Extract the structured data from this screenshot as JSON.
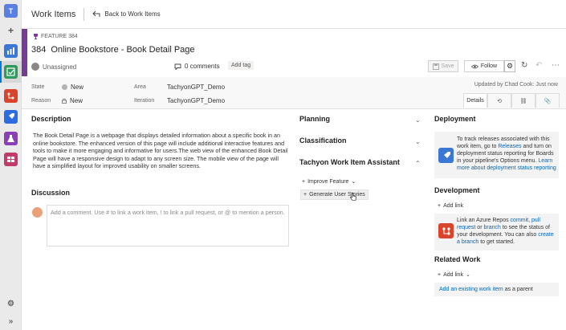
{
  "rail": {
    "avatar_letter": "T",
    "add_label": "+",
    "bottom_settings": "⚙",
    "bottom_expand": "»"
  },
  "header": {
    "title": "Work Items",
    "back_label": "Back to Work Items"
  },
  "work_item": {
    "type_label": "FEATURE 384",
    "id": "384",
    "title": "Online Bookstore - Book Detail Page",
    "assigned": "Unassigned",
    "comments": "0 comments",
    "add_tag": "Add tag",
    "save_label": "Save",
    "follow_label": "Follow",
    "accent_color": "#773b93"
  },
  "fields": {
    "state_label": "State",
    "state_value": "New",
    "reason_label": "Reason",
    "reason_value": "New",
    "area_label": "Area",
    "area_value": "TachyonGPT_Demo",
    "iteration_label": "Iteration",
    "iteration_value": "TachyonGPT_Demo",
    "updated": "Updated by Chad Cook: Just now",
    "details_tab": "Details"
  },
  "description": {
    "title": "Description",
    "text": "The Book Detail Page is a webpage that displays detailed information about a specific book in an online bookstore. The enhanced version of this page will include additional interactive features and tools to make it more engaging and informative for users.The web view of the enhanced Book Detail Page will have a responsive design to adapt to any screen size. The mobile view of the page will have a simplified layout for improved usability on smaller screens."
  },
  "discussion": {
    "title": "Discussion",
    "placeholder": "Add a comment. Use # to link a work item, ! to link a pull request, or @ to mention a person."
  },
  "middle": {
    "planning": "Planning",
    "classification": "Classification",
    "assistant": "Tachyon Work Item Assistant",
    "improve_feature": "Improve Feature",
    "generate_stories": "Generate User Stories"
  },
  "right": {
    "deployment_title": "Deployment",
    "deployment_text_1": "To track releases associated with this work item, go to ",
    "deployment_link_1": "Releases",
    "deployment_text_2": " and turn on deployment status reporting for Boards in your pipeline's Options menu. ",
    "deployment_link_2": "Learn more about deployment status reporting",
    "development_title": "Development",
    "add_link": "Add link",
    "dev_text_1": "Link an Azure Repos ",
    "dev_link_commit": "commit",
    "dev_text_2": ", ",
    "dev_link_pr": "pull request",
    "dev_text_3": " or ",
    "dev_link_branch": "branch",
    "dev_text_4": " to see the status of your development. You can also ",
    "dev_link_create": "create a branch",
    "dev_text_5": " to get started.",
    "related_title": "Related Work",
    "related_add_link": "Add link",
    "existing_link": "Add an existing work item",
    "existing_suffix": " as a parent"
  }
}
